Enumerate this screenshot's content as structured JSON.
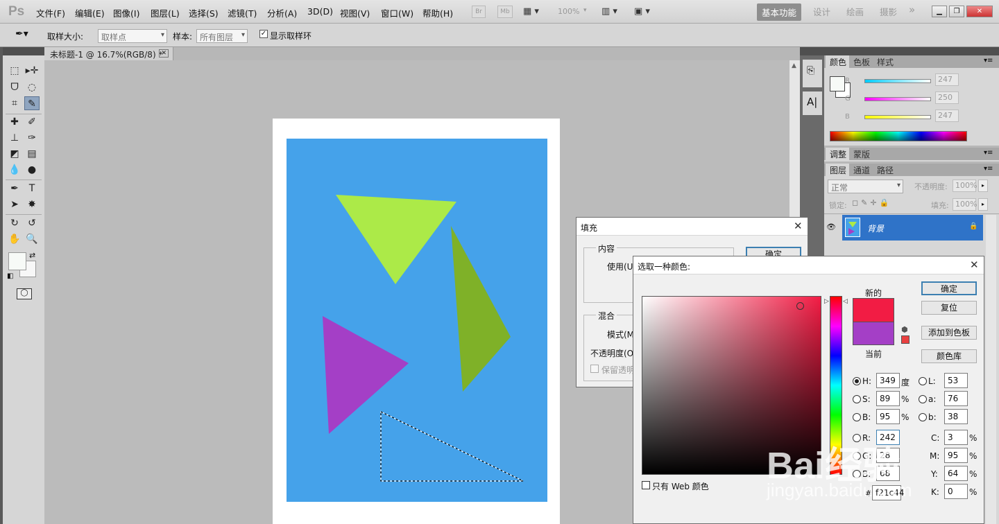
{
  "app": {
    "logo": "Ps"
  },
  "menu": [
    "文件(F)",
    "编辑(E)",
    "图像(I)",
    "图层(L)",
    "选择(S)",
    "滤镜(T)",
    "分析(A)",
    "3D(D)",
    "视图(V)",
    "窗口(W)",
    "帮助(H)"
  ],
  "appbar": {
    "bridge": "Br",
    "minibridge": "Mb",
    "zoom": "100%"
  },
  "workspaces": {
    "active": "基本功能",
    "items": [
      "设计",
      "绘画",
      "摄影"
    ],
    "more": "»"
  },
  "options": {
    "size_label": "取样大小:",
    "size_value": "取样点",
    "sample_label": "样本:",
    "sample_value": "所有图层",
    "ring_label": "显示取样环",
    "ring_checked": true
  },
  "document": {
    "tab_title": "未标题-1 @ 16.7%(RGB/8) *",
    "background": "#45a2ea",
    "shapes": [
      {
        "name": "yellow-green",
        "color": "#acea48"
      },
      {
        "name": "green",
        "color": "#7fb128"
      },
      {
        "name": "purple",
        "color": "#a43fc6"
      }
    ]
  },
  "color_panel": {
    "tabs": [
      "颜色",
      "色板",
      "样式"
    ],
    "channels": [
      {
        "label": "R",
        "value": "247"
      },
      {
        "label": "G",
        "value": "250"
      },
      {
        "label": "B",
        "value": "247"
      }
    ]
  },
  "adjust_panel": {
    "tabs": [
      "调整",
      "蒙版"
    ]
  },
  "layers_panel": {
    "tabs": [
      "图层",
      "通道",
      "路径"
    ],
    "blend": "正常",
    "opacity_label": "不透明度:",
    "opacity": "100%",
    "lock_label": "锁定:",
    "fill_label": "填充:",
    "fill": "100%",
    "layer_name": "背景"
  },
  "fill_dialog": {
    "title": "填充",
    "content_group": "内容",
    "use_label": "使用(U",
    "ok": "确定",
    "blend_group": "混合",
    "mode_label": "模式(M",
    "opacity_label": "不透明度(O",
    "preserve_label": "保留透明"
  },
  "picker": {
    "title": "选取一种颜色:",
    "new_label": "新的",
    "current_label": "当前",
    "new_color": "#f21c44",
    "current_color": "#a43fc6",
    "buttons": {
      "ok": "确定",
      "reset": "复位",
      "add": "添加到色板",
      "libraries": "颜色库"
    },
    "hsb": [
      {
        "label": "H:",
        "value": "349",
        "unit": "度"
      },
      {
        "label": "S:",
        "value": "89",
        "unit": "%"
      },
      {
        "label": "B:",
        "value": "95",
        "unit": "%"
      }
    ],
    "rgb": [
      {
        "label": "R:",
        "value": "242"
      },
      {
        "label": "G:",
        "value": "28"
      },
      {
        "label": "B:",
        "value": "68"
      }
    ],
    "lab": [
      {
        "label": "L:",
        "value": "53"
      },
      {
        "label": "a:",
        "value": "76"
      },
      {
        "label": "b:",
        "value": "38"
      }
    ],
    "cmyk": [
      {
        "label": "C:",
        "value": "3",
        "unit": "%"
      },
      {
        "label": "M:",
        "value": "95",
        "unit": "%"
      },
      {
        "label": "Y:",
        "value": "64",
        "unit": "%"
      },
      {
        "label": "K:",
        "value": "0",
        "unit": "%"
      }
    ],
    "hex": "f21c44",
    "hex_label": "#",
    "web_only": "只有 Web 颜色"
  },
  "watermark": {
    "text": "Bai经验",
    "sub": "jingyan.baidu.com"
  }
}
